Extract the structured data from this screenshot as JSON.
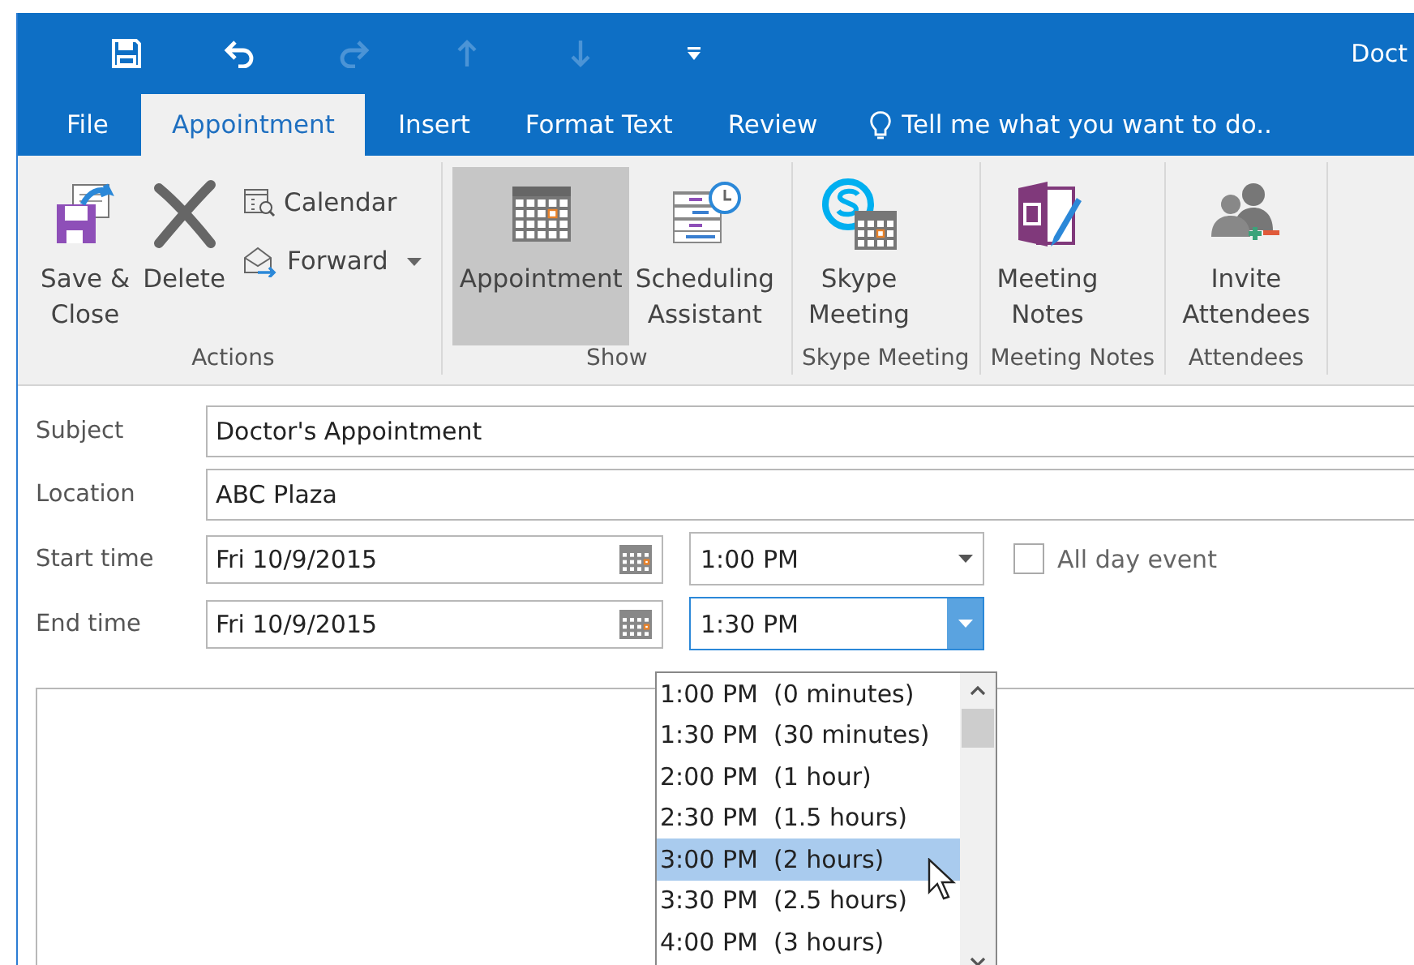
{
  "title_bar": {
    "title": "Doct"
  },
  "tabs": [
    {
      "label": "File",
      "selected": false
    },
    {
      "label": "Appointment",
      "selected": true
    },
    {
      "label": "Insert",
      "selected": false
    },
    {
      "label": "Format Text",
      "selected": false
    },
    {
      "label": "Review",
      "selected": false
    }
  ],
  "tell_me": "Tell me what you want to do..",
  "ribbon": {
    "groups": [
      {
        "label": "Actions",
        "items": [
          {
            "kind": "large",
            "label": "Save &\nClose",
            "selected": false
          },
          {
            "kind": "large",
            "label": "Delete",
            "selected": false
          },
          {
            "kind": "small",
            "label": "Calendar",
            "dropdown": false
          },
          {
            "kind": "small",
            "label": "Forward",
            "dropdown": true
          }
        ]
      },
      {
        "label": "Show",
        "items": [
          {
            "kind": "large",
            "label": "Appointment",
            "selected": true
          },
          {
            "kind": "large",
            "label": "Scheduling\nAssistant",
            "selected": false
          }
        ]
      },
      {
        "label": "Skype Meeting",
        "items": [
          {
            "kind": "large",
            "label": "Skype\nMeeting",
            "selected": false
          }
        ]
      },
      {
        "label": "Meeting Notes",
        "items": [
          {
            "kind": "large",
            "label": "Meeting\nNotes",
            "selected": false
          }
        ]
      },
      {
        "label": "Attendees",
        "items": [
          {
            "kind": "large",
            "label": "Invite\nAttendees",
            "selected": false
          }
        ]
      }
    ]
  },
  "form": {
    "subject": {
      "label": "Subject",
      "value": "Doctor's Appointment"
    },
    "location": {
      "label": "Location",
      "value": "ABC Plaza"
    },
    "start_time": {
      "label": "Start time",
      "date": "Fri 10/9/2015",
      "time": "1:00 PM",
      "focused": false
    },
    "end_time": {
      "label": "End time",
      "date": "Fri 10/9/2015",
      "time": "1:30 PM",
      "focused": true
    },
    "all_day_event": {
      "label": "All day event",
      "checked": false
    }
  },
  "time_dropdown": {
    "options": [
      {
        "label": "1:00 PM  (0 minutes)",
        "selected": false
      },
      {
        "label": "1:30 PM  (30 minutes)",
        "selected": false
      },
      {
        "label": "2:00 PM  (1 hour)",
        "selected": false
      },
      {
        "label": "2:30 PM  (1.5 hours)",
        "selected": false
      },
      {
        "label": "3:00 PM  (2 hours)",
        "selected": true
      },
      {
        "label": "3:30 PM  (2.5 hours)",
        "selected": false
      },
      {
        "label": "4:00 PM  (3 hours)",
        "selected": false
      }
    ]
  }
}
